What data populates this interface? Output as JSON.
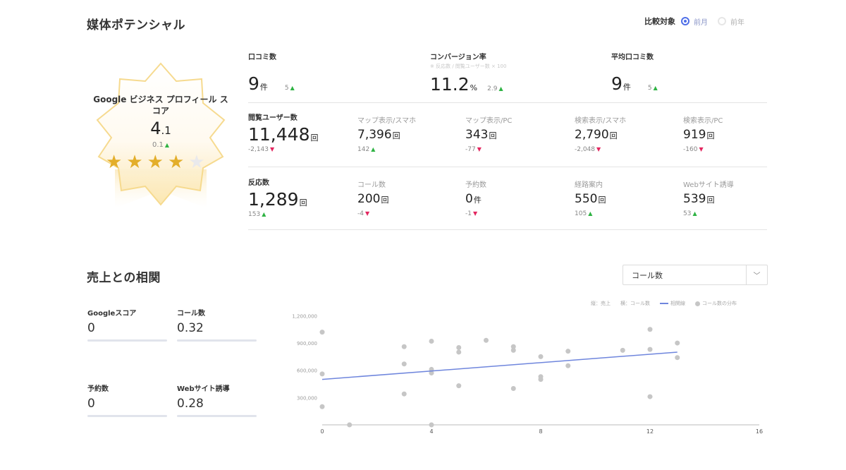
{
  "potential": {
    "title": "媒体ポテンシャル",
    "compare_label": "比較対象",
    "compare_options": [
      "前月",
      "前年"
    ],
    "score_title": "Google ビジネス プロフィール スコア",
    "score_int": "4",
    "score_dec": ".1",
    "score_delta": "0.1",
    "stars_filled": 4,
    "stars_total": 5,
    "reviews": {
      "label": "口コミ数",
      "value": "9",
      "unit": "件",
      "delta": "5"
    },
    "conversion": {
      "label": "コンバージョン率",
      "sub": "※ 反応数 / 閲覧ユーザー数 × 100",
      "value": "11.2",
      "unit": "%",
      "delta": "2.9"
    },
    "avg_reviews": {
      "label": "平均口コミ数",
      "value": "9",
      "unit": "件",
      "delta": "5"
    },
    "views": {
      "label": "閲覧ユーザー数",
      "value": "11,448",
      "unit": "回",
      "delta": "-2,143"
    },
    "map_sp": {
      "label": "マップ表示/スマホ",
      "value": "7,396",
      "unit": "回",
      "delta": "142"
    },
    "map_pc": {
      "label": "マップ表示/PC",
      "value": "343",
      "unit": "回",
      "delta": "-77"
    },
    "search_sp": {
      "label": "検索表示/スマホ",
      "value": "2,790",
      "unit": "回",
      "delta": "-2,048"
    },
    "search_pc": {
      "label": "検索表示/PC",
      "value": "919",
      "unit": "回",
      "delta": "-160"
    },
    "reactions": {
      "label": "反応数",
      "value": "1,289",
      "unit": "回",
      "delta": "153"
    },
    "calls": {
      "label": "コール数",
      "value": "200",
      "unit": "回",
      "delta": "-4"
    },
    "bookings": {
      "label": "予約数",
      "value": "0",
      "unit": "件",
      "delta": "-1"
    },
    "directions": {
      "label": "経路案内",
      "value": "550",
      "unit": "回",
      "delta": "105"
    },
    "website": {
      "label": "Webサイト誘導",
      "value": "539",
      "unit": "回",
      "delta": "53"
    }
  },
  "correlation": {
    "title": "売上との相関",
    "dropdown_value": "コール数",
    "stats": {
      "google_score": {
        "label": "Googleスコア",
        "value": "0"
      },
      "calls": {
        "label": "コール数",
        "value": "0.32"
      },
      "bookings": {
        "label": "予約数",
        "value": "0"
      },
      "website": {
        "label": "Webサイト誘導",
        "value": "0.28"
      }
    },
    "legend": {
      "y": "縦：売上",
      "x": "横：コール数",
      "trend": "相関線",
      "dots": "コール数の分布"
    }
  },
  "colors": {
    "accent": "#4f6fe8",
    "up": "#2fb344",
    "down": "#e3265f",
    "star": "#e3ae2a",
    "trend": "#6f86dd",
    "dot": "#c6c6c6"
  },
  "chart_data": {
    "type": "scatter",
    "x_ticks": [
      "0",
      "4",
      "8",
      "12",
      "16"
    ],
    "y_ticks": [
      "1,200,000",
      "900,000",
      "600,000",
      "300,000"
    ],
    "xlim": [
      0,
      16
    ],
    "ylim": [
      0,
      1250000
    ],
    "points": [
      [
        0,
        1020000
      ],
      [
        0,
        560000
      ],
      [
        0,
        200000
      ],
      [
        1,
        0
      ],
      [
        3,
        860000
      ],
      [
        3,
        670000
      ],
      [
        3,
        340000
      ],
      [
        4,
        920000
      ],
      [
        4,
        610000
      ],
      [
        4,
        570000
      ],
      [
        4,
        0
      ],
      [
        5,
        850000
      ],
      [
        5,
        800000
      ],
      [
        5,
        430000
      ],
      [
        6,
        930000
      ],
      [
        7,
        860000
      ],
      [
        7,
        820000
      ],
      [
        7,
        400000
      ],
      [
        8,
        750000
      ],
      [
        8,
        530000
      ],
      [
        8,
        500000
      ],
      [
        9,
        810000
      ],
      [
        9,
        650000
      ],
      [
        11,
        820000
      ],
      [
        12,
        1050000
      ],
      [
        12,
        830000
      ],
      [
        12,
        310000
      ],
      [
        13,
        900000
      ],
      [
        13,
        740000
      ]
    ],
    "trend": [
      [
        0,
        500000
      ],
      [
        13,
        800000
      ]
    ]
  }
}
